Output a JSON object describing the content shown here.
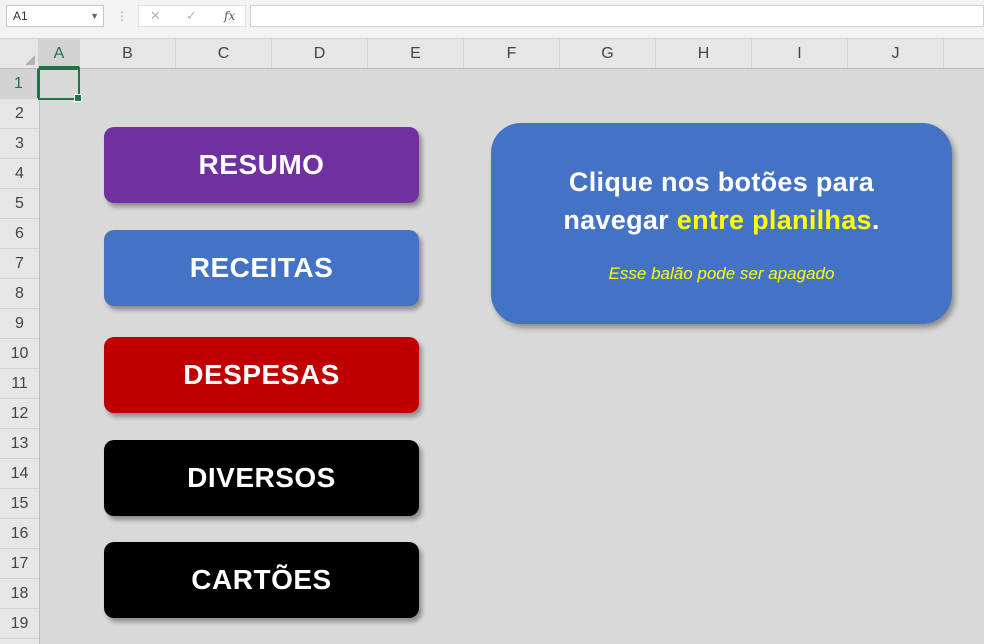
{
  "formula_bar": {
    "name_box": "A1",
    "cancel_symbol": "✕",
    "enter_symbol": "✓",
    "fx_label": "fx",
    "formula_value": ""
  },
  "columns": [
    "A",
    "B",
    "C",
    "D",
    "E",
    "F",
    "G",
    "H",
    "I",
    "J"
  ],
  "rows": [
    "1",
    "2",
    "3",
    "4",
    "5",
    "6",
    "7",
    "8",
    "9",
    "10",
    "11",
    "12",
    "13",
    "14",
    "15",
    "16",
    "17",
    "18",
    "19"
  ],
  "buttons": [
    {
      "label": "RESUMO",
      "color": "#7030a0"
    },
    {
      "label": "RECEITAS",
      "color": "#4472c4"
    },
    {
      "label": "DESPESAS",
      "color": "#c00000"
    },
    {
      "label": "DIVERSOS",
      "color": "#000000"
    },
    {
      "label": "CARTÕES",
      "color": "#000000"
    }
  ],
  "balloon": {
    "line1": "Clique nos botões para",
    "line2_prefix": "navegar ",
    "line2_highlight": "entre planilhas",
    "line2_suffix": ".",
    "note": "Esse balão pode ser apagado",
    "background": "#4472c4",
    "highlight_color": "#ffff00"
  }
}
